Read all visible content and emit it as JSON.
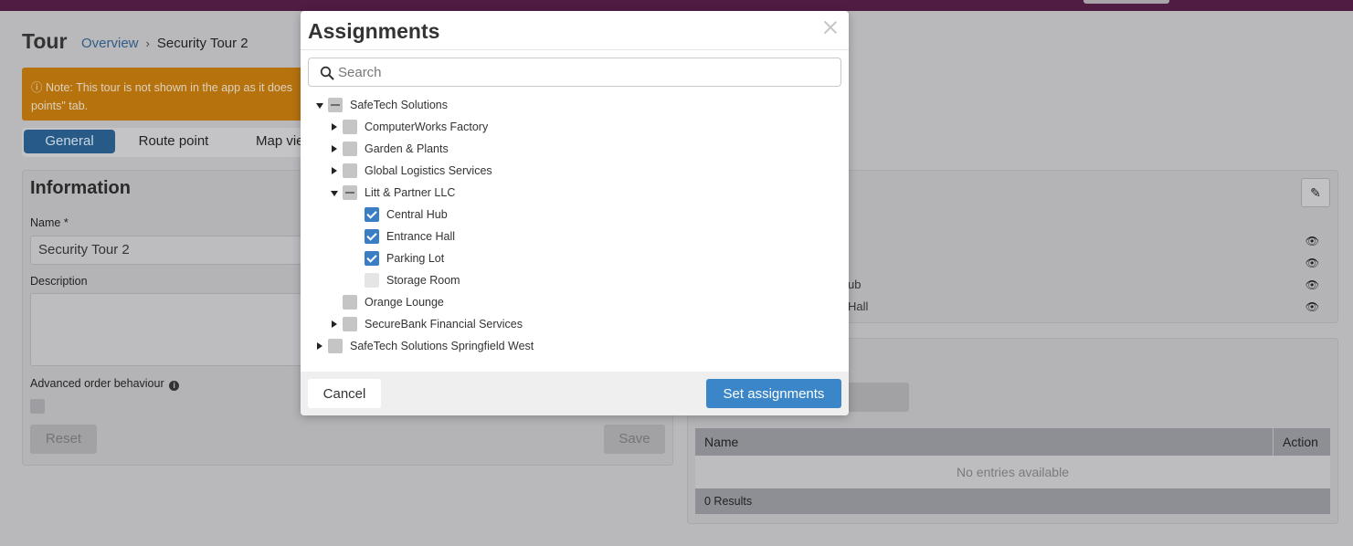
{
  "page": {
    "title": "Tour",
    "breadcrumb": {
      "overview": "Overview",
      "current": "Security Tour 2"
    },
    "note": "Note: This tour is not shown in the app as it does",
    "note_line2": "points\" tab.",
    "tabs": [
      "General",
      "Route point",
      "Map vie"
    ]
  },
  "info_panel": {
    "title": "Information",
    "name_label": "Name *",
    "name_value": "Security Tour 2",
    "description_label": "Description",
    "advanced_label": "Advanced order behaviour",
    "reset_label": "Reset",
    "save_label": "Save"
  },
  "right_panel": {
    "fragment_hub": "ub",
    "fragment_hall": "Hall"
  },
  "table": {
    "col_name": "Name",
    "col_action": "Action",
    "empty": "No entries available",
    "results": "0 Results"
  },
  "modal": {
    "title": "Assignments",
    "search_placeholder": "Search",
    "cancel_label": "Cancel",
    "set_label": "Set assignments",
    "tree": [
      {
        "label": "SafeTech Solutions",
        "level": 0,
        "caret": "down",
        "state": "partial"
      },
      {
        "label": "ComputerWorks Factory",
        "level": 1,
        "caret": "right",
        "state": "unchecked"
      },
      {
        "label": "Garden & Plants",
        "level": 1,
        "caret": "right",
        "state": "unchecked"
      },
      {
        "label": "Global Logistics Services",
        "level": 1,
        "caret": "right",
        "state": "unchecked"
      },
      {
        "label": "Litt & Partner LLC",
        "level": 1,
        "caret": "down",
        "state": "partial"
      },
      {
        "label": "Central Hub",
        "level": 2,
        "caret": "none",
        "state": "checked"
      },
      {
        "label": "Entrance Hall",
        "level": 2,
        "caret": "none",
        "state": "checked"
      },
      {
        "label": "Parking Lot",
        "level": 2,
        "caret": "none",
        "state": "checked"
      },
      {
        "label": "Storage Room",
        "level": 2,
        "caret": "none",
        "state": "unchecked-light"
      },
      {
        "label": "Orange Lounge",
        "level": 1,
        "caret": "none",
        "state": "unchecked"
      },
      {
        "label": "SecureBank Financial Services",
        "level": 1,
        "caret": "right",
        "state": "unchecked"
      },
      {
        "label": "SafeTech Solutions Springfield West",
        "level": 0,
        "caret": "right",
        "state": "unchecked"
      }
    ]
  },
  "colors": {
    "topbar": "#501c44",
    "primary": "#3b86c8",
    "warning": "#b6720d"
  }
}
